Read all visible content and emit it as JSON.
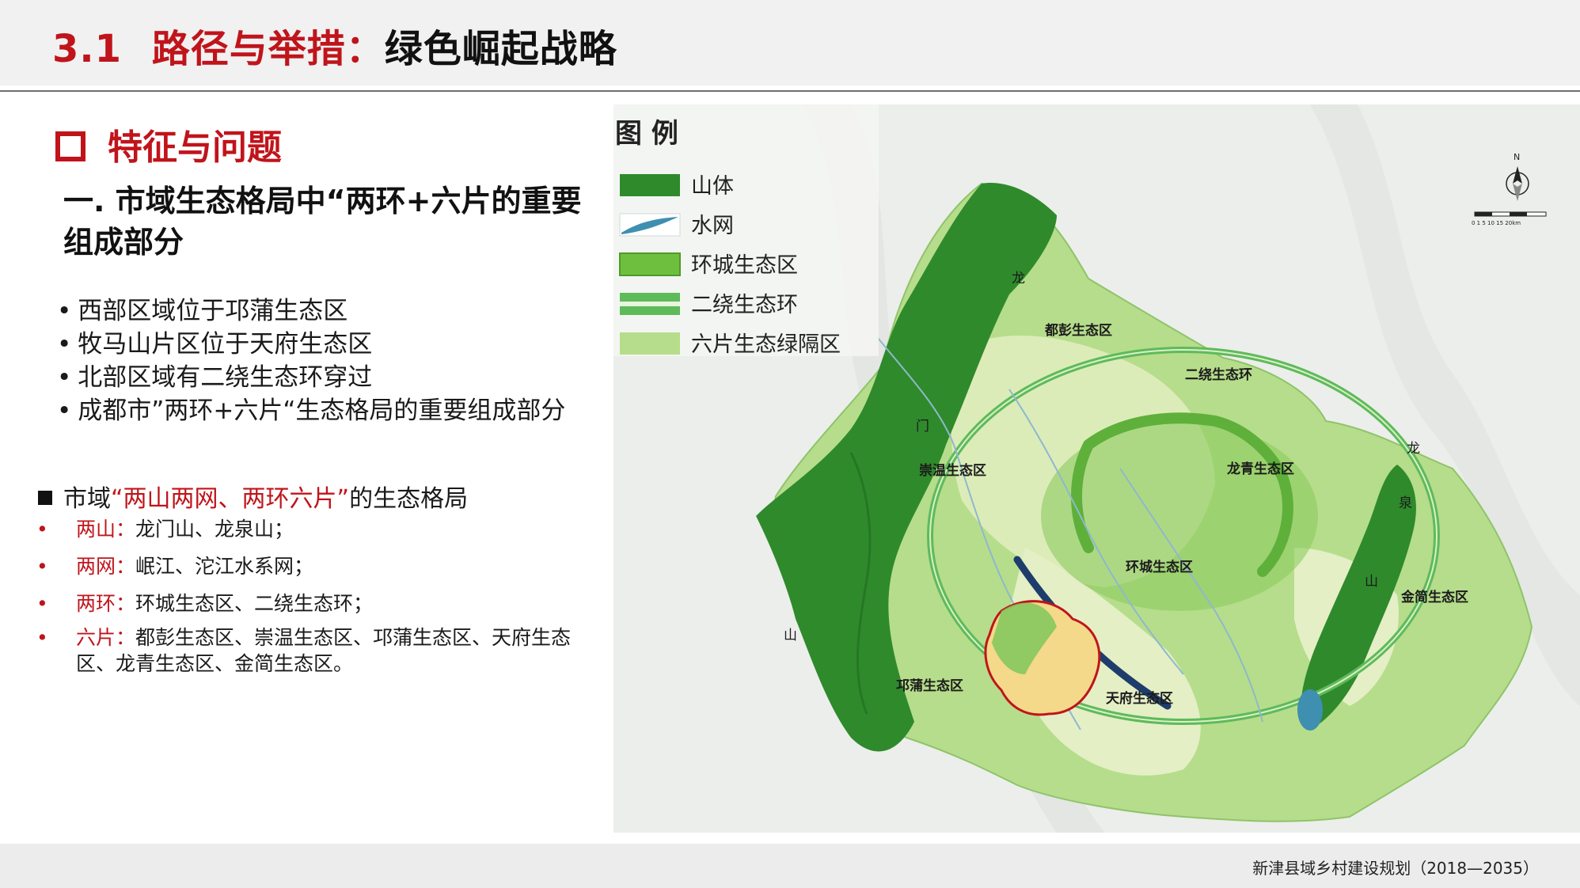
{
  "header": {
    "title_number": "3.1",
    "title_red": "路径与举措：",
    "title_black": "绿色崛起战略"
  },
  "left": {
    "section_title": "特征与问题",
    "sub_heading": "一.  市域生态格局中“两环+六片的重要组成部分",
    "bullets": [
      "西部区域位于邛蒲生态区",
      "牧马山片区位于天府生态区",
      "北部区域有二绕生态环穿过",
      "成都市”两环+六片“生态格局的重要组成部分"
    ],
    "pattern_heading_prefix": "市域",
    "pattern_heading_quoted": "“两山两网、两环六片”",
    "pattern_heading_suffix": "的生态格局",
    "pattern_items": [
      {
        "term": "两山：",
        "text": "龙门山、龙泉山；"
      },
      {
        "term": "两网：",
        "text": "岷江、沱江水系网；"
      },
      {
        "term": "两环：",
        "text": "环城生态区、二绕生态环；"
      },
      {
        "term": "六片：",
        "text": "都彭生态区、崇温生态区、邛蒲生态区、天府生态区、龙青生态区、金简生态区。"
      }
    ]
  },
  "map": {
    "legend": {
      "title": "图 例",
      "items": [
        {
          "label": "山体",
          "color": "#2f8a2c"
        },
        {
          "label": "水网",
          "color": "#3f8fb0"
        },
        {
          "label": "环城生态区",
          "color": "#6fbf3f"
        },
        {
          "label": "二绕生态环",
          "color": "#5fba5a"
        },
        {
          "label": "六片生态绿隔区",
          "color": "#b6dd8b"
        }
      ]
    },
    "zone_labels": {
      "dupeng": "都彭生态区",
      "chongwen": "崇温生态区",
      "longqing": "龙青生态区",
      "huancheng": "环城生态区",
      "jinjian": "金简生态区",
      "qiongpu": "邛蒲生态区",
      "tianfu": "天府生态区",
      "erraoring": "二绕生态环"
    },
    "mountain_chars": {
      "longmen": [
        "龙",
        "门",
        "山"
      ],
      "longquan": [
        "龙",
        "泉",
        "山"
      ]
    },
    "north_arrow": "N",
    "scale_text": "0 1 5   10   15   20km",
    "colors": {
      "mountain": "#2f8a2c",
      "greenbelt": "#b6dd8b",
      "ring": "#5fba5a",
      "xinjin_boundary": "#c0141b",
      "xinjin_fill": "#f4d98a",
      "corridor": "#1f3d6b"
    }
  },
  "footer": {
    "text": "新津县域乡村建设规划（2018—2035）"
  }
}
